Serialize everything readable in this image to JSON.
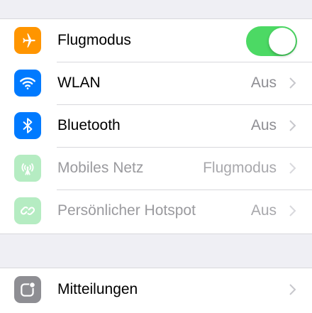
{
  "settings_group_1": [
    {
      "id": "airplane",
      "label": "Flugmodus",
      "icon": "airplane-icon",
      "icon_color": "#ff9500",
      "toggle_on": true
    },
    {
      "id": "wlan",
      "label": "WLAN",
      "value": "Aus",
      "icon": "wifi-icon",
      "icon_color": "#007aff"
    },
    {
      "id": "bluetooth",
      "label": "Bluetooth",
      "value": "Aus",
      "icon": "bluetooth-icon",
      "icon_color": "#007aff"
    },
    {
      "id": "cellular",
      "label": "Mobiles Netz",
      "value": "Flugmodus",
      "icon": "antenna-icon",
      "icon_color": "#b5ecc2",
      "disabled": true
    },
    {
      "id": "hotspot",
      "label": "Persönlicher Hotspot",
      "value": "Aus",
      "icon": "hotspot-icon",
      "icon_color": "#b5ecc2",
      "disabled": true
    }
  ],
  "settings_group_2": [
    {
      "id": "notifications",
      "label": "Mitteilungen",
      "icon": "notifications-icon",
      "icon_color": "#8e8e93"
    }
  ],
  "colors": {
    "toggle_on": "#4cd964",
    "background": "#efeff4"
  }
}
